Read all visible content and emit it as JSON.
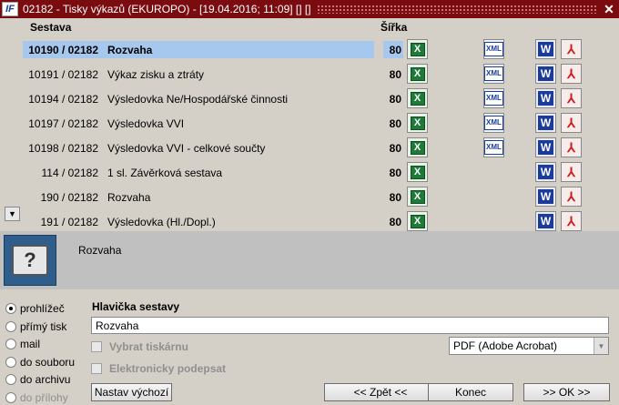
{
  "window": {
    "icon_label": "IF",
    "title": "02182 - Tisky výkazů (EKUROPO) - [19.04.2016; 11:09] [] []",
    "close_label": "✕"
  },
  "list": {
    "col_sestava": "Sestava",
    "col_sirka": "Šířka",
    "rows": [
      {
        "code": "10190 / 02182",
        "name": "Rozvaha",
        "width": "80",
        "selected": true,
        "xml": true
      },
      {
        "code": "10191 / 02182",
        "name": "Výkaz zisku a ztráty",
        "width": "80",
        "xml": true
      },
      {
        "code": "10194 / 02182",
        "name": "Výsledovka Ne/Hospodářské činnosti",
        "width": "80",
        "xml": true
      },
      {
        "code": "10197 / 02182",
        "name": "Výsledovka VVI",
        "width": "80",
        "xml": true
      },
      {
        "code": "10198 / 02182",
        "name": "Výsledovka VVI - celkové součty",
        "width": "80",
        "xml": true
      },
      {
        "code": "114 / 02182",
        "name": "1 sl. Závěrková sestava",
        "width": "80",
        "xml": false
      },
      {
        "code": "190 / 02182",
        "name": "Rozvaha",
        "width": "80",
        "xml": false
      },
      {
        "code": "191 / 02182",
        "name": "Výsledovka (Hl./Dopl.)",
        "width": "80",
        "xml": false
      }
    ],
    "glyphs": {
      "excel": "X",
      "xml": "XML",
      "word": "W",
      "pdf": "⅄",
      "scroll_down": "▼"
    }
  },
  "info": {
    "printer_glyph": "?",
    "title": "Rozvaha"
  },
  "output_options": [
    {
      "label": "prohlížeč",
      "checked": true,
      "disabled": false
    },
    {
      "label": "přímý tisk",
      "checked": false,
      "disabled": false
    },
    {
      "label": "mail",
      "checked": false,
      "disabled": false
    },
    {
      "label": "do souboru",
      "checked": false,
      "disabled": false
    },
    {
      "label": "do archivu",
      "checked": false,
      "disabled": false
    },
    {
      "label": "do přílohy",
      "checked": false,
      "disabled": true
    }
  ],
  "header_section": {
    "label": "Hlavička sestavy",
    "value": "Rozvaha"
  },
  "checkboxes": {
    "select_printer": "Vybrat tiskárnu",
    "e_sign": "Elektronicky podepsat"
  },
  "format_select": {
    "value": "PDF (Adobe Acrobat)",
    "arrow": "▼"
  },
  "buttons": {
    "defaults": "Nastav výchozí",
    "back": "<< Zpět <<",
    "end": "Konec",
    "ok": ">> OK >>"
  }
}
